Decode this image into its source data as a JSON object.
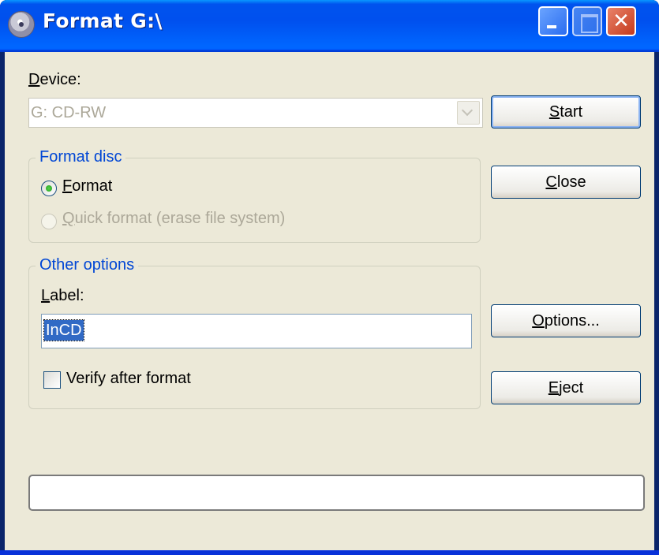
{
  "window": {
    "title": "Format G:\\"
  },
  "device": {
    "label": "Device:",
    "selected": "G: CD-RW"
  },
  "buttons": {
    "start": "Start",
    "close": "Close",
    "options": "Options...",
    "eject": "Eject"
  },
  "format_group": {
    "title": "Format disc",
    "options": [
      {
        "label": "Format",
        "checked": true,
        "enabled": true
      },
      {
        "label": "Quick format (erase file system)",
        "checked": false,
        "enabled": false
      }
    ]
  },
  "other_group": {
    "title": "Other options",
    "label_caption": "Label:",
    "label_value": "InCD",
    "verify_label": "Verify after format",
    "verify_checked": false
  },
  "progress": {
    "value": 0
  }
}
